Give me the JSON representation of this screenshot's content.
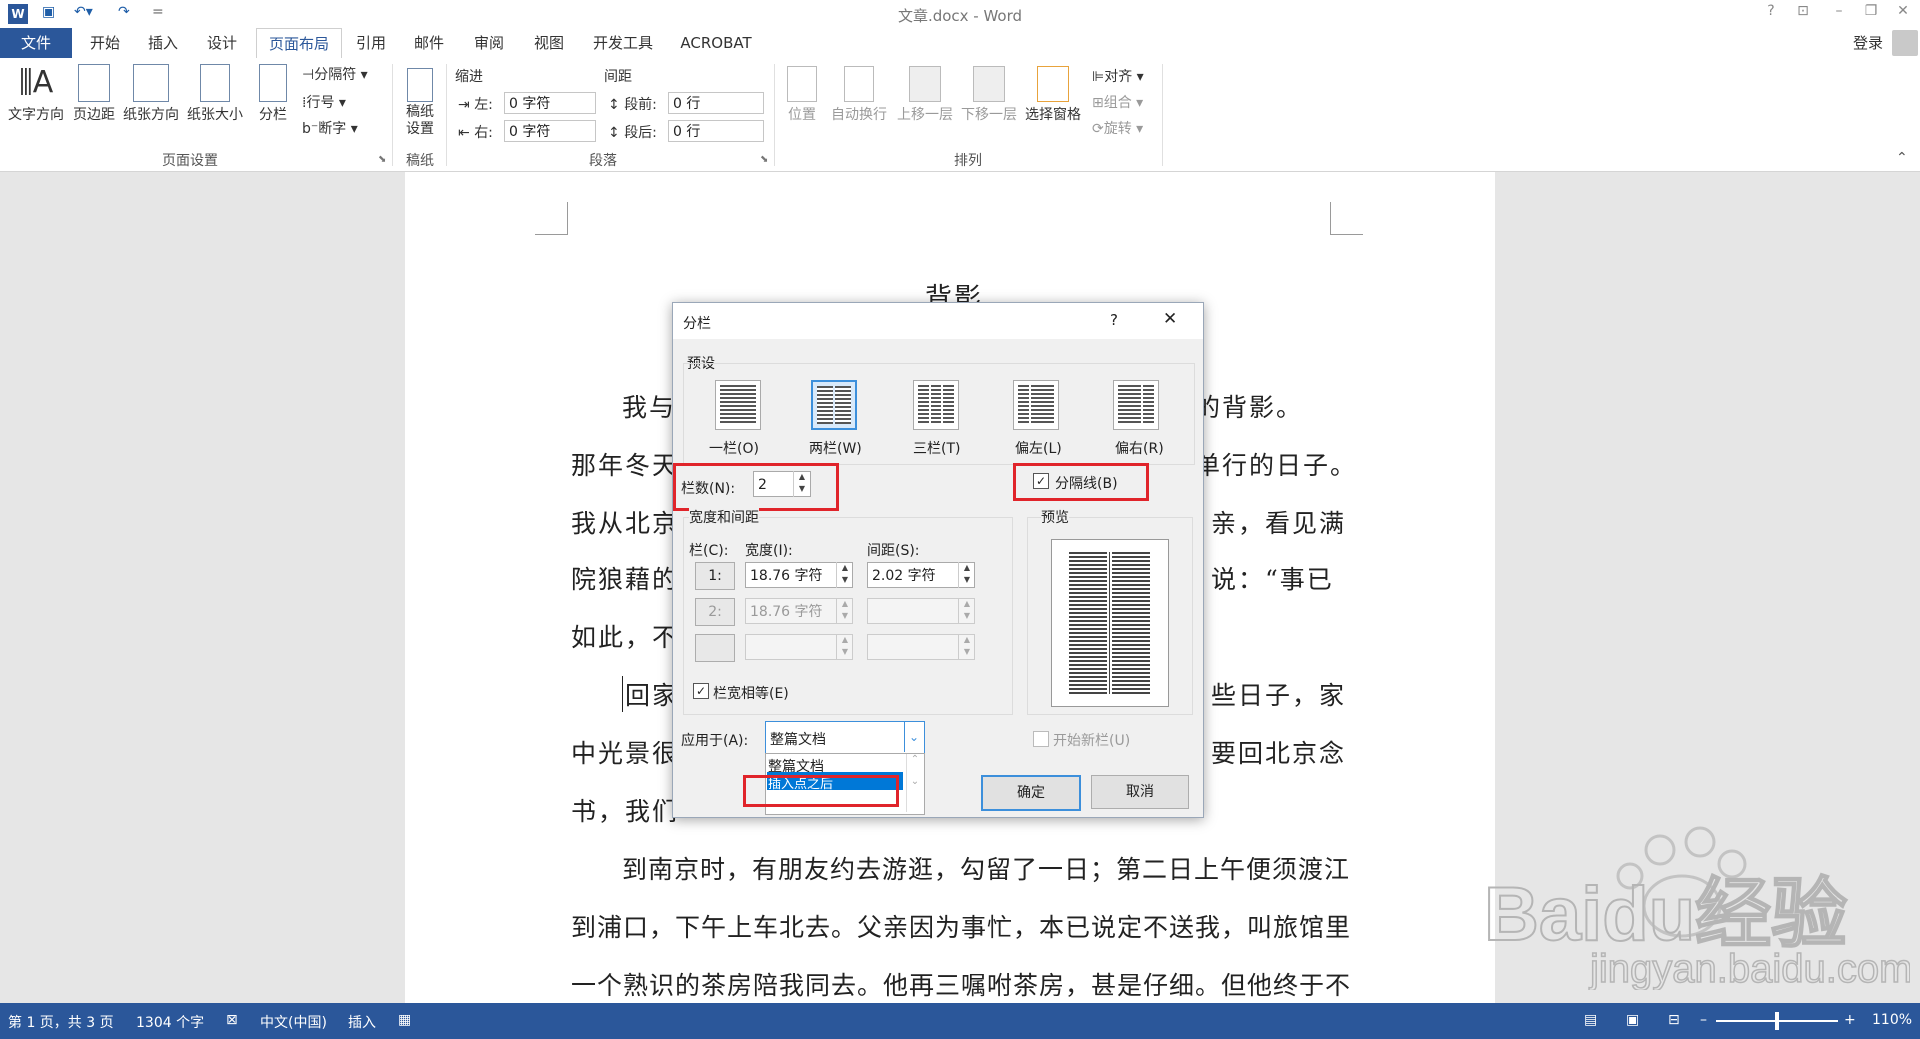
{
  "window": {
    "title": "文章.docx - Word",
    "help": "?",
    "login": "登录"
  },
  "quick_access": {
    "save_icon": "save-icon",
    "undo_icon": "undo-icon",
    "redo_icon": "redo-icon",
    "more": "="
  },
  "tabs": [
    "文件",
    "开始",
    "插入",
    "设计",
    "页面布局",
    "引用",
    "邮件",
    "审阅",
    "视图",
    "开发工具",
    "ACROBAT"
  ],
  "active_tab": "页面布局",
  "ribbon": {
    "page_setup": {
      "label": "页面设置",
      "buttons": [
        "文字方向",
        "页边距",
        "纸张方向",
        "纸张大小",
        "分栏"
      ],
      "small": [
        "分隔符",
        "行号",
        "断字"
      ]
    },
    "draft": {
      "label": "稿纸",
      "button": "稿纸设置"
    },
    "paragraph": {
      "label": "段落",
      "indent_title": "缩进",
      "spacing_title": "间距",
      "left_label": "左:",
      "left_value": "0 字符",
      "right_label": "右:",
      "right_value": "0 字符",
      "before_label": "段前:",
      "before_value": "0 行",
      "after_label": "段后:",
      "after_value": "0 行"
    },
    "arrange": {
      "label": "排列",
      "buttons": [
        "位置",
        "自动换行",
        "上移一层",
        "下移一层",
        "选择窗格"
      ],
      "small": [
        "对齐",
        "组合",
        "旋转"
      ]
    }
  },
  "document": {
    "title": "背影",
    "lines": [
      {
        "left": "我与",
        "right": "的背影。"
      },
      {
        "left": "那年冬天",
        "right": "单行的日子。"
      },
      {
        "left": "我从北京",
        "right": "亲，看见满"
      },
      {
        "left": "院狼藉的",
        "right": "说：“事已"
      },
      {
        "left": "如此，不",
        "right": ""
      },
      {
        "left": "回家",
        "right": "些日子，家"
      },
      {
        "left": "中光景很",
        "right": "要回北京念"
      },
      {
        "left": "书，我们",
        "right": ""
      }
    ],
    "full_lines": [
      "到南京时，有朋友约去游逛，勾留了一日；第二日上午便须渡江",
      "到浦口，下午上车北去。父亲因为事忙，本已说定不送我，叫旅馆里",
      "一个熟识的茶房陪我同去。他再三嘱咐茶房，甚是仔细。但他终于不"
    ]
  },
  "dialog": {
    "title": "分栏",
    "help": "?",
    "close": "✕",
    "presets_label": "预设",
    "presets": [
      "一栏(O)",
      "两栏(W)",
      "三栏(T)",
      "偏左(L)",
      "偏右(R)"
    ],
    "selected_preset": "两栏(W)",
    "columns_label": "栏数(N):",
    "columns_value": "2",
    "divider_label": "分隔线(B)",
    "divider_checked": true,
    "width_spacing_label": "宽度和间距",
    "col_header": "栏(C):",
    "width_header": "宽度(I):",
    "spacing_header": "间距(S):",
    "rows": [
      {
        "num": "1:",
        "width": "18.76 字符",
        "spacing": "2.02 字符"
      },
      {
        "num": "2:",
        "width": "18.76 字符",
        "spacing": ""
      },
      {
        "num": "",
        "width": "",
        "spacing": ""
      }
    ],
    "equal_width_label": "栏宽相等(E)",
    "equal_width_checked": true,
    "preview_label": "预览",
    "apply_label": "应用于(A):",
    "apply_value": "整篇文档",
    "apply_options": [
      "整篇文档",
      "插入点之后"
    ],
    "highlighted_option": "插入点之后",
    "new_column_label": "开始新栏(U)",
    "ok": "确定",
    "cancel": "取消"
  },
  "status": {
    "page": "第 1 页，共 3 页",
    "words": "1304 个字",
    "language": "中文(中国)",
    "mode": "插入",
    "zoom": "110%"
  },
  "watermark": {
    "brand": "Baidu经验",
    "url": "jingyan.baidu.com"
  },
  "colors": {
    "accent": "#2b579a",
    "highlight": "#e0242a",
    "selection": "#3c8fdb"
  }
}
